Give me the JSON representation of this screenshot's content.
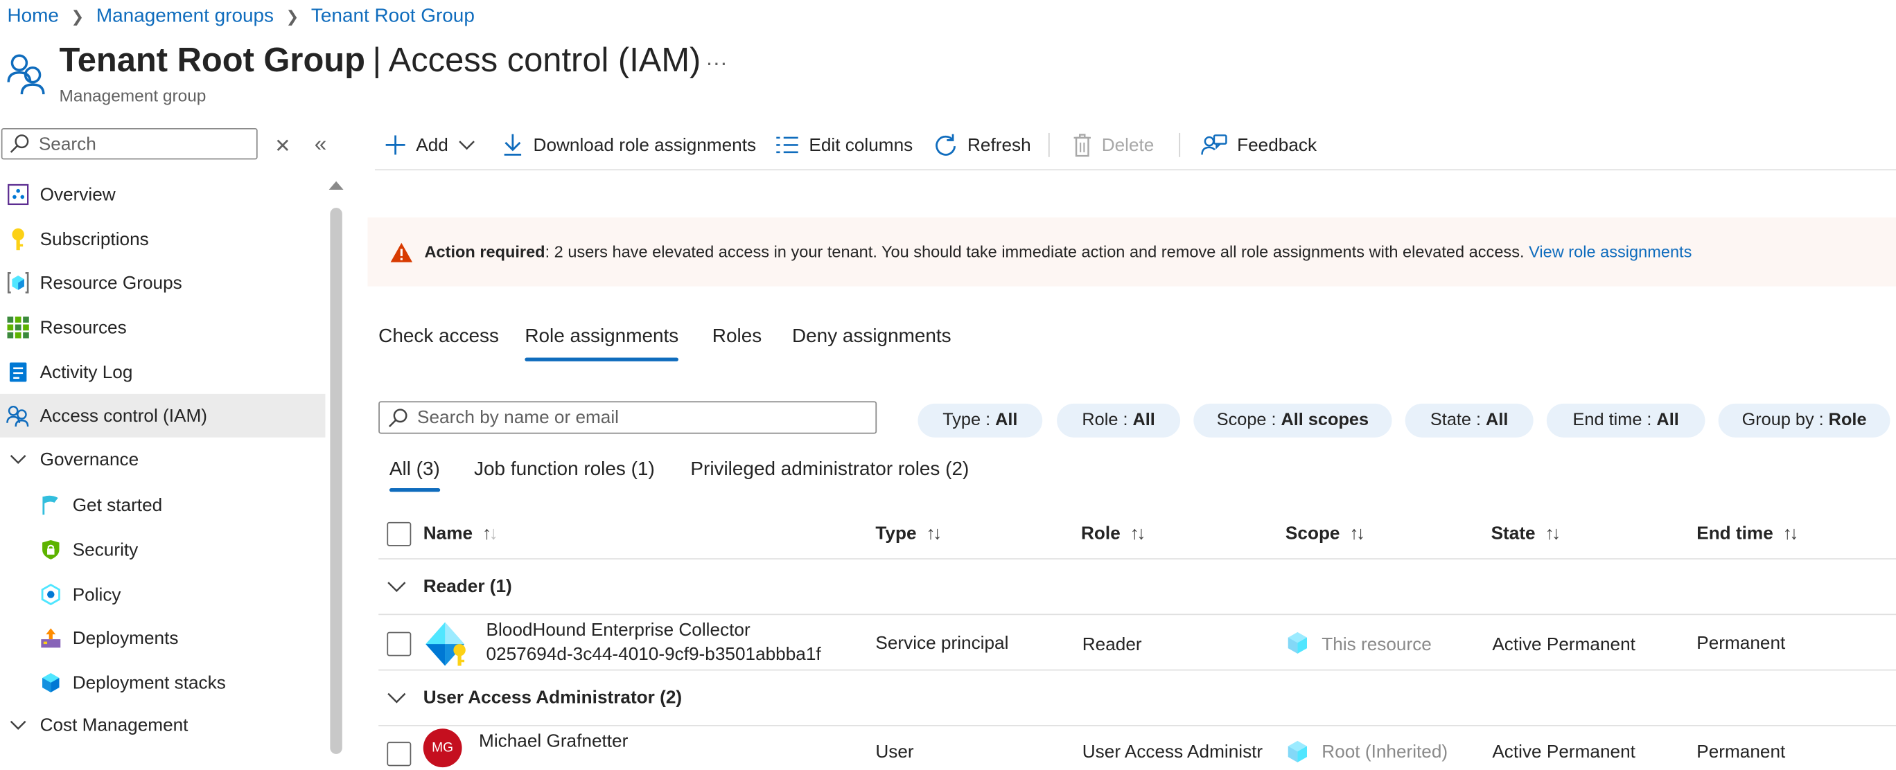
{
  "breadcrumb": [
    "Home",
    "Management groups",
    "Tenant Root Group"
  ],
  "page": {
    "title_main": "Tenant Root Group",
    "title_sep": "|",
    "title_sub": "Access control (IAM)",
    "subtitle": "Management group",
    "more": "..."
  },
  "sidebar": {
    "search_placeholder": "Search",
    "items": [
      {
        "label": "Overview",
        "icon": "overview-icon"
      },
      {
        "label": "Subscriptions",
        "icon": "key-icon"
      },
      {
        "label": "Resource Groups",
        "icon": "resource-groups-icon"
      },
      {
        "label": "Resources",
        "icon": "grid-icon"
      },
      {
        "label": "Activity Log",
        "icon": "activity-log-icon"
      },
      {
        "label": "Access control (IAM)",
        "icon": "people-icon",
        "active": true
      },
      {
        "label": "Governance",
        "icon": "chevron-down-icon",
        "section": true
      },
      {
        "label": "Get started",
        "icon": "flag-icon"
      },
      {
        "label": "Security",
        "icon": "shield-icon"
      },
      {
        "label": "Policy",
        "icon": "policy-icon"
      },
      {
        "label": "Deployments",
        "icon": "deployments-icon"
      },
      {
        "label": "Deployment stacks",
        "icon": "cube-icon"
      },
      {
        "label": "Cost Management",
        "icon": "chevron-down-icon",
        "section": true
      }
    ]
  },
  "toolbar": {
    "add": "Add",
    "download": "Download role assignments",
    "edit_columns": "Edit columns",
    "refresh": "Refresh",
    "delete": "Delete",
    "feedback": "Feedback"
  },
  "banner": {
    "bold": "Action required",
    "text": ": 2 users have elevated access in your tenant. You should take immediate action and remove all role assignments with elevated access.",
    "link": "View role assignments"
  },
  "tabs": [
    "Check access",
    "Role assignments",
    "Roles",
    "Deny assignments"
  ],
  "active_tab": "Role assignments",
  "filter": {
    "search_placeholder": "Search by name or email",
    "pills": [
      {
        "label": "Type :",
        "value": "All"
      },
      {
        "label": "Role :",
        "value": "All"
      },
      {
        "label": "Scope :",
        "value": "All scopes"
      },
      {
        "label": "State :",
        "value": "All"
      },
      {
        "label": "End time :",
        "value": "All"
      },
      {
        "label": "Group by :",
        "value": "Role"
      }
    ]
  },
  "subtabs": [
    "All (3)",
    "Job function roles (1)",
    "Privileged administrator roles (2)"
  ],
  "table": {
    "columns": [
      "Name",
      "Type",
      "Role",
      "Scope",
      "State",
      "End time"
    ],
    "groups": [
      {
        "name": "Reader (1)",
        "rows": [
          {
            "name": "BloodHound Enterprise Collector",
            "id": "0257694d-3c44-4010-9cf9-b3501abbba1f",
            "type": "Service principal",
            "role": "Reader",
            "scope": "This resource",
            "state": "Active Permanent",
            "end_time": "Permanent"
          }
        ]
      },
      {
        "name": "User Access Administrator (2)",
        "rows": [
          {
            "name": "Michael Grafnetter",
            "initials": "MG",
            "type": "User",
            "role": "User Access Administr",
            "scope": "Root (Inherited)",
            "state": "Active Permanent",
            "end_time": "Permanent"
          }
        ]
      }
    ]
  },
  "colors": {
    "accent": "#0f6cbd",
    "warning": "#d83b01",
    "banner_bg": "#fdf6f3",
    "pill_bg": "#e8f1fa",
    "avatar": "#c50f1f"
  }
}
